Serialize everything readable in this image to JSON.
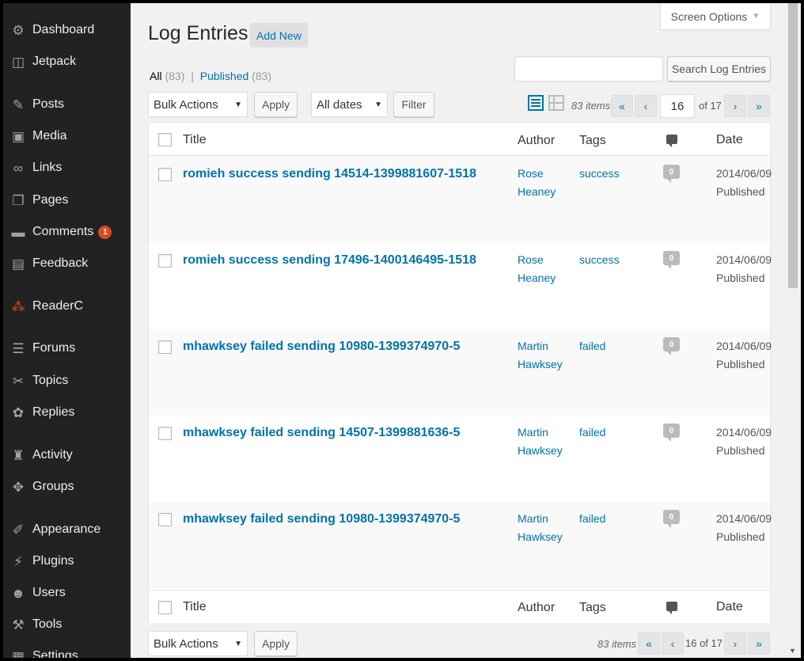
{
  "sidebar": {
    "items": [
      {
        "label": "Dashboard",
        "icon": "dashboard-icon",
        "glyph": "⚙"
      },
      {
        "label": "Jetpack",
        "icon": "jetpack-icon",
        "glyph": "◫"
      },
      {
        "label": "Posts",
        "icon": "pin-icon",
        "glyph": "✎"
      },
      {
        "label": "Media",
        "icon": "media-icon",
        "glyph": "▣"
      },
      {
        "label": "Links",
        "icon": "link-icon",
        "glyph": "∞"
      },
      {
        "label": "Pages",
        "icon": "pages-icon",
        "glyph": "❐"
      },
      {
        "label": "Comments",
        "icon": "comments-icon",
        "glyph": "▬",
        "badge": "1"
      },
      {
        "label": "Feedback",
        "icon": "feedback-icon",
        "glyph": "▤"
      },
      {
        "label": "ReaderC",
        "icon": "readerc-icon",
        "glyph": "⁂"
      },
      {
        "label": "Forums",
        "icon": "forums-icon",
        "glyph": "☰"
      },
      {
        "label": "Topics",
        "icon": "topics-icon",
        "glyph": "✂"
      },
      {
        "label": "Replies",
        "icon": "replies-icon",
        "glyph": "✿"
      },
      {
        "label": "Activity",
        "icon": "activity-icon",
        "glyph": "♜"
      },
      {
        "label": "Groups",
        "icon": "groups-icon",
        "glyph": "✥"
      },
      {
        "label": "Appearance",
        "icon": "appearance-icon",
        "glyph": "✐"
      },
      {
        "label": "Plugins",
        "icon": "plugins-icon",
        "glyph": "⚡"
      },
      {
        "label": "Users",
        "icon": "users-icon",
        "glyph": "☻"
      },
      {
        "label": "Tools",
        "icon": "tools-icon",
        "glyph": "⚒"
      },
      {
        "label": "Settings",
        "icon": "settings-icon",
        "glyph": "▦"
      }
    ]
  },
  "header": {
    "title": "Log Entries",
    "add_new": "Add New",
    "screen_options": "Screen Options"
  },
  "filters": {
    "all_label": "All",
    "all_count": "(83)",
    "sep": "|",
    "published_label": "Published",
    "published_count": "(83)",
    "search_button": "Search Log Entries",
    "search_value": "",
    "bulk_actions": "Bulk Actions",
    "apply": "Apply",
    "dates": "All dates",
    "filter": "Filter"
  },
  "pagination": {
    "items": "83 items",
    "first": "«",
    "prev": "‹",
    "current": "16",
    "of_total": "of 17",
    "next": "›",
    "last": "»",
    "bottom_text": "16 of 17"
  },
  "table": {
    "columns": {
      "title": "Title",
      "author": "Author",
      "tags": "Tags",
      "date": "Date"
    },
    "rows": [
      {
        "title": "romieh success sending 14514-1399881607-1518",
        "author": "Rose Heaney",
        "tags": "success",
        "comments": "0",
        "date": "2014/06/09 Published"
      },
      {
        "title": "romieh success sending 17496-1400146495-1518",
        "author": "Rose Heaney",
        "tags": "success",
        "comments": "0",
        "date": "2014/06/09 Published"
      },
      {
        "title": "mhawksey failed sending 10980-1399374970-5",
        "author": "Martin Hawksey",
        "tags": "failed",
        "comments": "0",
        "date": "2014/06/09 Published"
      },
      {
        "title": "mhawksey failed sending 14507-1399881636-5",
        "author": "Martin Hawksey",
        "tags": "failed",
        "comments": "0",
        "date": "2014/06/09 Published"
      },
      {
        "title": "mhawksey failed sending 10980-1399374970-5",
        "author": "Martin Hawksey",
        "tags": "failed",
        "comments": "0",
        "date": "2014/06/09 Published"
      }
    ]
  },
  "colors": {
    "accent": "#0073aa",
    "sidebar_bg": "#222222",
    "badge": "#d54e21"
  }
}
